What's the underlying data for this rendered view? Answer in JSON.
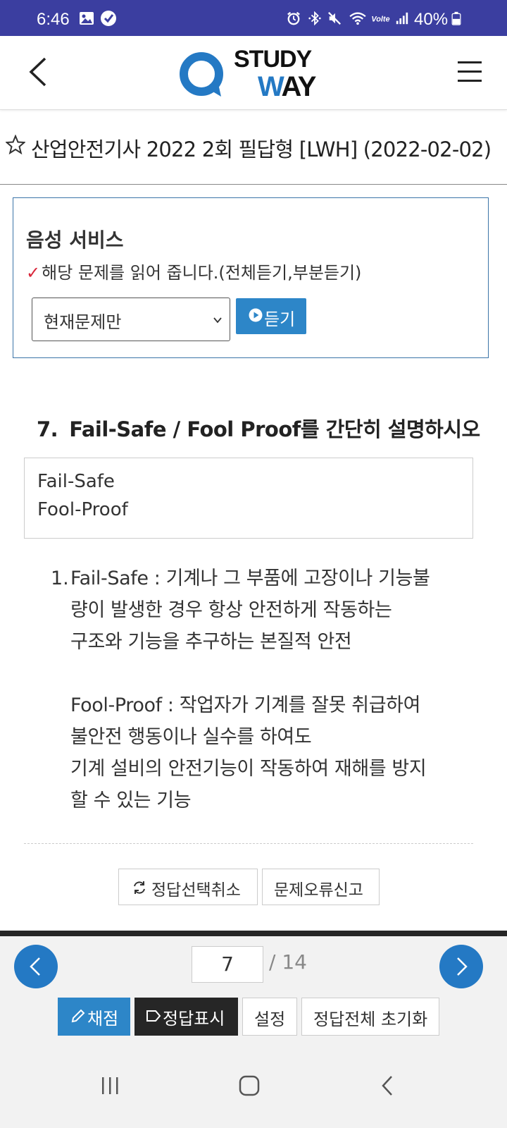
{
  "status_bar": {
    "time": "6:46",
    "battery": "40%",
    "icons": [
      "gallery-icon",
      "check-badge-icon",
      "alarm-icon",
      "bluetooth-icon",
      "mute-icon",
      "wifi-icon",
      "volte-icon",
      "signal-icon",
      "battery-icon"
    ]
  },
  "header": {
    "logo_top": "STUDY",
    "logo_bottom_w": "W",
    "logo_bottom_rest": "AY"
  },
  "exam_title": "산업안전기사 2022 2회 필답형 [LWH] (2022-02-02)",
  "voice": {
    "title": "음성 서비스",
    "check": "✓",
    "description": "해당 문제를 읽어 줍니다.(전체듣기,부분듣기)",
    "select_value": "현재문제만",
    "listen_label": "듣기"
  },
  "question": {
    "number": "7.",
    "text": "Fail-Safe / Fool Proof를 간단히 설명하시오"
  },
  "hint_lines": [
    "Fail-Safe",
    "Fool-Proof"
  ],
  "answer": {
    "number": "1.",
    "lines": [
      "Fail-Safe : 기계나 그 부품에 고장이나 기능불",
      "량이 발생한 경우 항상 안전하게 작동하는",
      "구조와 기능을 추구하는 본질적 안전",
      "",
      "Fool-Proof : 작업자가 기계를 잘못 취급하여",
      "불안전 행동이나 실수를 하여도",
      "기계 설비의 안전기능이 작동하여 재해를 방지",
      "할 수 있는 기능"
    ]
  },
  "actions": {
    "reset_selection": "정답선택취소",
    "report_error": "문제오류신고"
  },
  "pagination": {
    "current": "7",
    "total": "/ 14"
  },
  "toolbar": {
    "grade": "채점",
    "show_answer": "정답표시",
    "settings": "설정",
    "reset_all": "정답전체 초기화"
  },
  "colors": {
    "status_bar": "#3b3ea0",
    "accent_blue": "#2479c4",
    "button_blue": "#2d86c8",
    "dark_button": "#262626"
  }
}
